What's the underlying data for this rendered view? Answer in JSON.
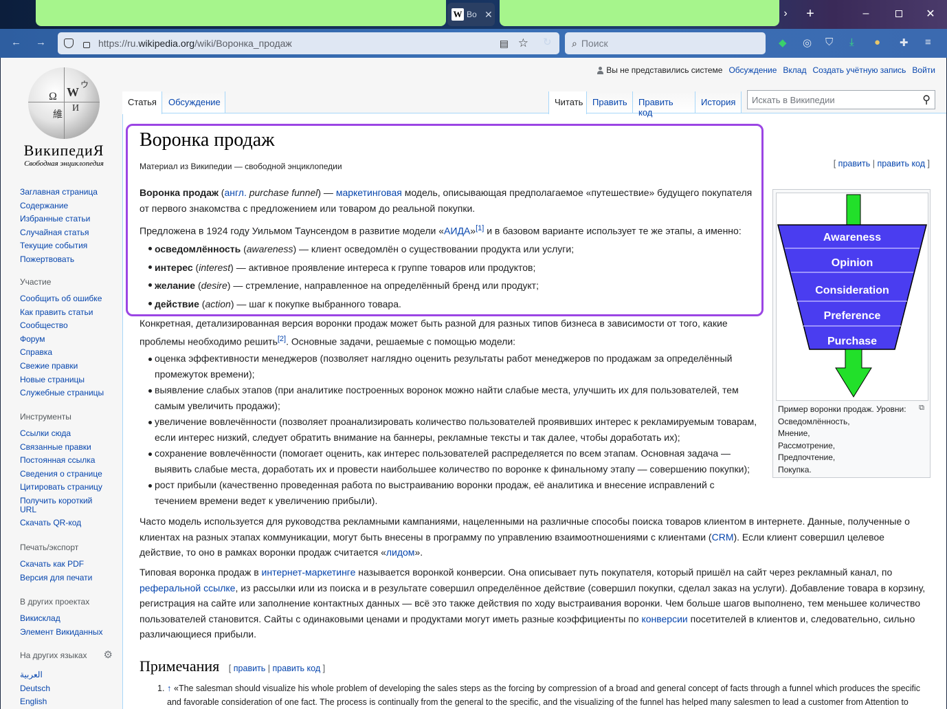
{
  "browser": {
    "tab_title": "Во",
    "url_prefix": "https://ru.",
    "url_domain": "wikipedia.org",
    "url_path": "/wiki/Воронка_продаж",
    "search_placeholder": "Поиск"
  },
  "logo": {
    "wordmark": "ВикипедиЯ",
    "tagline": "Свободная энциклопедия"
  },
  "sidebar": {
    "main": [
      "Заглавная страница",
      "Содержание",
      "Избранные статьи",
      "Случайная статья",
      "Текущие события",
      "Пожертвовать"
    ],
    "participation_head": "Участие",
    "participation": [
      "Сообщить об ошибке",
      "Как править статьи",
      "Сообщество",
      "Форум",
      "Справка",
      "Свежие правки",
      "Новые страницы",
      "Служебные страницы"
    ],
    "tools_head": "Инструменты",
    "tools": [
      "Ссылки сюда",
      "Связанные правки",
      "Постоянная ссылка",
      "Сведения о странице",
      "Цитировать страницу",
      "Получить короткий URL",
      "Скачать QR-код"
    ],
    "print_head": "Печать/экспорт",
    "print": [
      "Скачать как PDF",
      "Версия для печати"
    ],
    "projects_head": "В других проектах",
    "projects": [
      "Викисклад",
      "Элемент Викиданных"
    ],
    "languages_head": "На других языках",
    "languages": [
      "العربية",
      "Deutsch",
      "English"
    ]
  },
  "personal": {
    "not_logged": "Вы не представились системе",
    "links": [
      "Обсуждение",
      "Вклад",
      "Создать учётную запись",
      "Войти"
    ]
  },
  "tabs": {
    "article": "Статья",
    "talk": "Обсуждение",
    "read": "Читать",
    "edit": "Править",
    "edit_source": "Править код",
    "history": "История",
    "search_placeholder": "Искать в Википедии"
  },
  "article": {
    "title": "Воронка продаж",
    "subtitle": "Материал из Википедии — свободной энциклопедии",
    "edit_open": "[",
    "edit": "править",
    "sep": "|",
    "edit_source": "править код",
    "edit_close": "]",
    "p1": {
      "bold": "Воронка продаж",
      "t1": " (",
      "lang": "англ.",
      "term": " purchase funnel",
      "t2": ") — ",
      "link": "маркетинговая",
      "t3": " модель, описывающая предполагаемое «путешествие» будущего покупателя от первого знакомства с предложением или товаром до реальной покупки."
    },
    "p2": {
      "t1": "Предложена в 1924 году Уильмом Таунсендом в развитие модели «",
      "link": "АИДА",
      "t2": "»",
      "ref": "[1]",
      "t3": " и в базовом варианте использует те же этапы, а именно:"
    },
    "stages": [
      {
        "bold": "осведомлённость",
        "it": "awareness",
        "rest": " — клиент осведомлён о существовании продукта или услуги;"
      },
      {
        "bold": "интерес",
        "it": "interest",
        "rest": " — активное проявление интереса к группе товаров или продуктов;"
      },
      {
        "bold": "желание",
        "it": "desire",
        "rest": " — стремление, направленное на определённый бренд или продукт;"
      },
      {
        "bold": "действие",
        "it": "action",
        "rest": " — шаг к покупке выбранного товара."
      }
    ],
    "p3": {
      "t1": "Конкретная, детализированная версия воронки продаж может быть разной для разных типов бизнеса в зависимости от того, какие проблемы необходимо решить",
      "ref": "[2]",
      "t2": ". Основные задачи, решаемые с помощью модели:"
    },
    "tasks": [
      "оценка эффективности менеджеров (позволяет наглядно оценить результаты работ менеджеров по продажам за определённый промежуток времени);",
      "выявление слабых этапов (при аналитике построенных воронок можно найти слабые места, улучшить их для пользователей, тем самым увеличить продажи);",
      "увеличение вовлечённости (позволяет проанализировать количество пользователей проявивших интерес к рекламируемым товарам, если интерес низкий, следует обратить внимание на баннеры, рекламные тексты и так далее, чтобы доработать их);",
      "сохранение вовлечённости (помогает оценить, как интерес пользователей распределяется по всем этапам. Основная задача — выявить слабые места, доработать их и провести наибольшее количество по воронке к финальному этапу — совершению покупки);",
      "рост прибыли (качественно проведенная работа по выстраиванию воронки продаж, её аналитика и внесение исправлений с течением времени ведет к увеличению прибыли)."
    ],
    "p4": {
      "t1": "Часто модель используется для руководства рекламными кампаниями, нацеленными на различные способы поиска товаров клиентом в интернете. Данные, полученные о клиентах на разных этапах коммуникации, могут быть внесены в программу по управлению взаимоотношениями с клиентами (",
      "link1": "CRM",
      "t2": "). Если клиент совершил целевое действие, то оно в рамках воронки продаж считается «",
      "link2": "лидом",
      "t3": "»."
    },
    "p5": {
      "t1": "Типовая воронка продаж в ",
      "link1": "интернет-маркетинге",
      "t2": " называется воронкой конверсии. Она описывает путь покупателя, который пришёл на сайт через рекламный канал, по ",
      "link2": "реферальной ссылке",
      "t3": ", из рассылки или из поиска и в результате совершил определённое действие (совершил покупки, сделал заказ на услуги). Добавление товара в корзину, регистрация на сайте или заполнение контактных данных — всё это также действия по ходу выстраивания воронки. Чем больше шагов выполнено, тем меньшее количество пользователей становится. Сайты с одинаковыми ценами и продуктами могут иметь разные коэффициенты по ",
      "link3": "конверсии",
      "t4": " посетителей в клиентов и, следовательно, сильно различающиеся прибыли."
    },
    "notes_title": "Примечания",
    "note1_num": "1.",
    "note1_arrow": "↑",
    "note1": "«The salesman should visualize his whole problem of developing the sales steps as the forcing by compression of a broad and general concept of facts through a funnel which produces the specific and favorable consideration of one fact. The process is continually from the general to the specific, and the visualizing of the funnel has helped many salesmen to lead a customer from Attention to"
  },
  "figure": {
    "levels": [
      "Awareness",
      "Opinion",
      "Consideration",
      "Preference",
      "Purchase"
    ],
    "caption": [
      "Пример воронки продаж. Уровни:",
      "Осведомлённость,",
      "Мнение,",
      "Рассмотрение,",
      "Предпочтение,",
      "Покупка."
    ],
    "funnel_color": "#4a3df0",
    "arrow_color": "#22e02a"
  }
}
